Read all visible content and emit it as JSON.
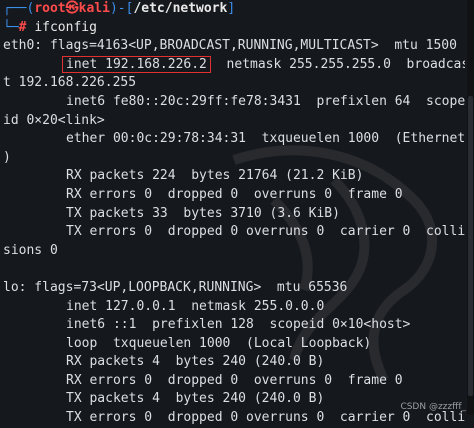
{
  "prompt": {
    "user": "root",
    "symbol": "㉿",
    "host": "kali",
    "path": "/etc/network",
    "command": "ifconfig",
    "hash": "#"
  },
  "eth0": {
    "header": "eth0: flags=4163<UP,BROADCAST,RUNNING,MULTICAST>  mtu 1500",
    "inet_label": "inet 192.168.226.2",
    "inet_rest": "  netmask 255.255.255.0  broadcas",
    "inet_wrap": "t 192.168.226.255",
    "inet6_1": "inet6 fe80::20c:29ff:fe78:3431  prefixlen 64  scope",
    "inet6_wrap": "id 0×20<link>",
    "ether": "ether 00:0c:29:78:34:31  txqueuelen 1000  (Ethernet",
    "ether_wrap": ")",
    "rx_packets": "RX packets 224  bytes 21764 (21.2 KiB)",
    "rx_errors": "RX errors 0  dropped 0  overruns 0  frame 0",
    "tx_packets": "TX packets 33  bytes 3710 (3.6 KiB)",
    "tx_errors": "TX errors 0  dropped 0 overruns 0  carrier 0  colli",
    "tx_errors_wrap": "sions 0"
  },
  "lo": {
    "header": "lo: flags=73<UP,LOOPBACK,RUNNING>  mtu 65536",
    "inet": "inet 127.0.0.1  netmask 255.0.0.0",
    "inet6": "inet6 ::1  prefixlen 128  scopeid 0×10<host>",
    "loop": "loop  txqueuelen 1000  (Local Loopback)",
    "rx_packets": "RX packets 4  bytes 240 (240.0 B)",
    "rx_errors": "RX errors 0  dropped 0  overruns 0  frame 0",
    "tx_packets": "TX packets 4  bytes 240 (240.0 B)",
    "tx_errors": "TX errors 0  dropped 0 overruns 0  carrier 0  colli"
  },
  "watermark": "CSDN @zzzfff_",
  "colors": {
    "background": "#15181c",
    "prompt_frame": "#3b8eea",
    "prompt_user": "#ff4b4b",
    "highlight": "#e03131"
  }
}
